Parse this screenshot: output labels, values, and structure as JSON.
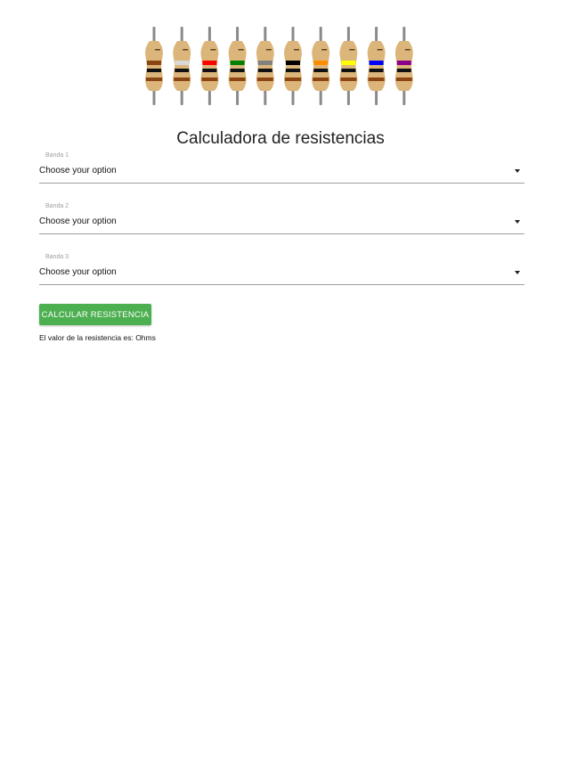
{
  "title": "Calculadora de resistencias",
  "resistor_colors": [
    "#8b4513",
    "#d9d9d9",
    "#ff0000",
    "#008000",
    "#808080",
    "#000000",
    "#ff8c00",
    "#ffff00",
    "#0000ff",
    "#8b008b"
  ],
  "fields": [
    {
      "label": "Banda 1",
      "value": "Choose your option"
    },
    {
      "label": "Banda 2",
      "value": "Choose your option"
    },
    {
      "label": "Banda 3",
      "value": "Choose your option"
    }
  ],
  "button_label": "CALCULAR RESISTENCIA",
  "result_text": "El valor de la resistencia es: Ohms",
  "colors": {
    "accent": "#4caf50",
    "body": "#dcb57a",
    "lead": "#8a8a8a"
  }
}
